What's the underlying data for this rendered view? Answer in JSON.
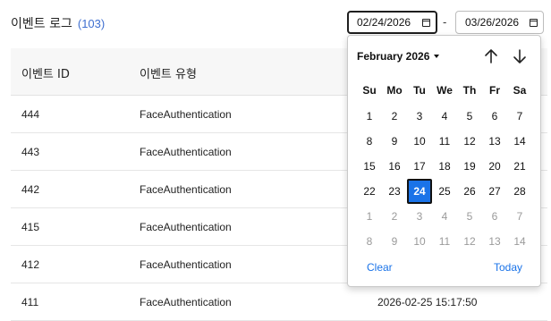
{
  "header": {
    "title": "이벤트 로그",
    "count": "(103)"
  },
  "filters": {
    "start_date": "02/24/2026",
    "end_date": "03/26/2026",
    "separator": "-"
  },
  "table": {
    "columns": [
      "이벤트 ID",
      "이벤트 유형"
    ],
    "rows": [
      {
        "id": "444",
        "type": "FaceAuthentication",
        "time": ""
      },
      {
        "id": "443",
        "type": "FaceAuthentication",
        "time": ""
      },
      {
        "id": "442",
        "type": "FaceAuthentication",
        "time": ""
      },
      {
        "id": "415",
        "type": "FaceAuthentication",
        "time": ""
      },
      {
        "id": "412",
        "type": "FaceAuthentication",
        "time": ""
      },
      {
        "id": "411",
        "type": "FaceAuthentication",
        "time": "2026-02-25 15:17:50"
      }
    ]
  },
  "datepicker": {
    "month_year": "February 2026",
    "weekdays": [
      "Su",
      "Mo",
      "Tu",
      "We",
      "Th",
      "Fr",
      "Sa"
    ],
    "weeks": [
      [
        "1",
        "2",
        "3",
        "4",
        "5",
        "6",
        "7"
      ],
      [
        "8",
        "9",
        "10",
        "11",
        "12",
        "13",
        "14"
      ],
      [
        "15",
        "16",
        "17",
        "18",
        "19",
        "20",
        "21"
      ],
      [
        "22",
        "23",
        "24",
        "25",
        "26",
        "27",
        "28"
      ],
      [
        "1",
        "2",
        "3",
        "4",
        "5",
        "6",
        "7"
      ],
      [
        "8",
        "9",
        "10",
        "11",
        "12",
        "13",
        "14"
      ]
    ],
    "selected_day": "24",
    "clear_label": "Clear",
    "today_label": "Today"
  },
  "colors": {
    "accent": "#1a73e8",
    "count": "#3f6fd0"
  },
  "icons": {
    "up": "arrow-up-icon",
    "down": "arrow-down-icon",
    "calendar": "calendar-icon"
  }
}
